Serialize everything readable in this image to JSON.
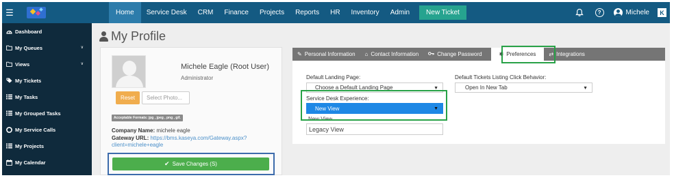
{
  "nav": {
    "items": [
      "Home",
      "Service Desk",
      "CRM",
      "Finance",
      "Projects",
      "Reports",
      "HR",
      "Inventory",
      "Admin"
    ],
    "new_ticket": "New Ticket",
    "user": "Michele",
    "k_logo": "K",
    "icons": [
      "menu-icon",
      "logo-icon",
      "bell-icon",
      "help-icon",
      "user-icon"
    ]
  },
  "sidebar": {
    "items": [
      {
        "label": "Dashboard",
        "icon": "dashboard-icon",
        "expandable": false
      },
      {
        "label": "My Queues",
        "icon": "folder-icon",
        "expandable": true
      },
      {
        "label": "Views",
        "icon": "folder-icon",
        "expandable": true
      },
      {
        "label": "My Tickets",
        "icon": "tag-icon",
        "expandable": false
      },
      {
        "label": "My Tasks",
        "icon": "list-icon",
        "expandable": false
      },
      {
        "label": "My Grouped Tasks",
        "icon": "list-icon",
        "expandable": false
      },
      {
        "label": "My Service Calls",
        "icon": "lifebuoy-icon",
        "expandable": false
      },
      {
        "label": "My Projects",
        "icon": "list-icon",
        "expandable": false
      },
      {
        "label": "My Calendar",
        "icon": "calendar-icon",
        "expandable": false
      }
    ]
  },
  "page": {
    "title": "My Profile"
  },
  "profile": {
    "name": "Michele Eagle (Root User)",
    "role": "Administrator",
    "reset_label": "Reset",
    "select_photo_label": "Select Photo...",
    "formats": "Acceptable Formats: jpg , jpeg , png , gif.",
    "company_label": "Company Name:",
    "company_value": "michele eagle",
    "gateway_label": "Gateway URL:",
    "gateway_value": "https://bms.kaseya.com/Gateway.aspx?client=michele+eagle",
    "save_label": "Save Changes (S)"
  },
  "tabs": [
    {
      "label": "Personal Information",
      "icon": "pencil-icon",
      "active": false
    },
    {
      "label": "Contact Information",
      "icon": "home-icon",
      "active": false
    },
    {
      "label": "Change Password",
      "icon": "key-icon",
      "active": false
    },
    {
      "label": "Preferences",
      "icon": "gear-icon",
      "active": true
    },
    {
      "label": "Integrations",
      "icon": "exchange-icon",
      "active": false
    }
  ],
  "preferences": {
    "landing_label": "Default Landing Page:",
    "landing_value": "Choose a Default Landing Page",
    "click_label": "Default Tickets Listing Click Behavior:",
    "click_value": "Open In New Tab",
    "sd_label": "Service Desk Experience:",
    "sd_value": "New View",
    "sd_options": [
      "New View",
      "Legacy View"
    ]
  },
  "colors": {
    "topnav": "#145a82",
    "sidebar": "#0f2a3c",
    "new_ticket": "#26a38f",
    "save": "#4cae4c",
    "reset": "#f0ad4e",
    "selected_option": "#1e88e5",
    "highlight_green": "#27a146",
    "highlight_blue": "#3c6bab"
  }
}
